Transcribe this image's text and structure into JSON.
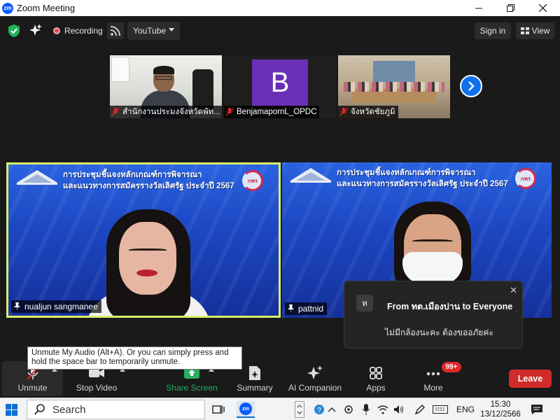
{
  "window": {
    "app_icon": "zm",
    "title": "Zoom Meeting",
    "controls": [
      "minimize-icon",
      "maximize-icon",
      "close-icon"
    ]
  },
  "topbar": {
    "shield_icon": "shield-check-icon",
    "sparkle_icon": "sparkle-icon",
    "recording_label": "Recording",
    "rss_icon": "rss-icon",
    "stream_label": "YouTube",
    "signin_label": "Sign in",
    "view_label": "View"
  },
  "thumbnails": [
    {
      "name": "สำนักงานประมงจังหวัดพัท...",
      "muted": true
    },
    {
      "name": "BenjamapornL_OPDC",
      "avatar_letter": "B",
      "avatar_color": "#6b2fb7",
      "muted": true
    },
    {
      "name": "จังหวัดชัยภูมิ",
      "muted": true
    }
  ],
  "gallery": {
    "next_icon": "chevron-right-icon"
  },
  "tiles": [
    {
      "name": "nualjun sangmanee",
      "active": true,
      "banner_line1": "การประชุมชี้แจงหลักเกณฑ์การพิจารณา",
      "banner_line2": "และแนวทางการสมัครรางวัลเลิศรัฐ ประจำปี 2567",
      "logo_right": "กพร"
    },
    {
      "name": "pattnid",
      "active": false,
      "banner_line1": "การประชุมชี้แจงหลักเกณฑ์การพิจารณา",
      "banner_line2": "และแนวทางการสมัครรางวัลเลิศรัฐ ประจำปี 2567",
      "logo_right": "กพร"
    }
  ],
  "chat_popup": {
    "avatar_letter": "ท",
    "from": "From ทต.เมืองปาน to Everyone",
    "message": "ไม่มีกล้องนะคะ ต้องขออภัยค่ะ",
    "close_icon": "close-icon"
  },
  "tooltip": {
    "text": "Unmute My Audio (Alt+A). Or you can simply press and hold the space bar to temporarily unmute."
  },
  "toolbar": {
    "unmute_label": "Unmute",
    "stop_video_label": "Stop Video",
    "share_screen_label": "Share Screen",
    "summary_label": "Summary",
    "ai_companion_label": "AI Companion",
    "apps_label": "Apps",
    "more_label": "More",
    "more_badge": "99+",
    "leave_label": "Leave",
    "colors": {
      "share": "#27ae60",
      "leave": "#d12b2b",
      "active_border": "#d7f06a"
    }
  },
  "taskbar": {
    "search_label": "Search",
    "language": "ENG",
    "time": "15:30",
    "date": "13/12/2566"
  }
}
